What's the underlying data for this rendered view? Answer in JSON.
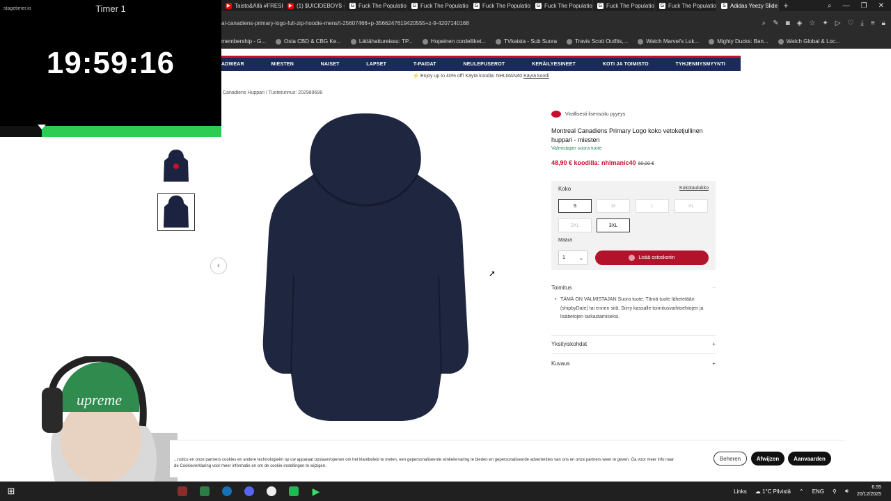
{
  "browser": {
    "tabs": [
      {
        "label": "Taisto&Allä #FRESH",
        "icon": "youtube-icon"
      },
      {
        "label": "(1) $UICIDEBOY$ -",
        "icon": "youtube-icon"
      },
      {
        "label": "Fuck The Populatio",
        "icon": "genius-icon"
      },
      {
        "label": "Fuck The Populatio",
        "icon": "genius-icon"
      },
      {
        "label": "Fuck The Populatio",
        "icon": "genius-icon"
      },
      {
        "label": "Fuck The Populatio",
        "icon": "genius-icon"
      },
      {
        "label": "Fuck The Populatio",
        "icon": "genius-icon"
      },
      {
        "label": "Fuck The Populatio",
        "icon": "genius-icon"
      },
      {
        "label": "Adidas Yeezy Slide",
        "icon": "shop-icon"
      }
    ],
    "url": "al-canadiens-primary-logo-full-zip-hoodie-mens/t-25607466+p-3566247619420555+z-9-4207140168",
    "bookmarks": [
      {
        "label": "membership - G..."
      },
      {
        "label": "Osta CBD & CBG Ke..."
      },
      {
        "label": "Lättähattureissu: TP..."
      },
      {
        "label": "Hopeinen cordelliket..."
      },
      {
        "label": "TVkaista - Sub Suora"
      },
      {
        "label": "Travis Scott Outfits,..."
      },
      {
        "label": "Watch Marvel's Luk..."
      },
      {
        "label": "Mighty Ducks: Ban..."
      },
      {
        "label": "Watch Global & Loc..."
      }
    ]
  },
  "site": {
    "nav": [
      "ADWEAR",
      "MIESTEN",
      "NAISET",
      "LAPSET",
      "T-PAIDAT",
      "NEULEPUSEROT",
      "KERÄILYESINEET",
      "KOTI JA TOIMISTO",
      "TYHJENNYSMYYNTI"
    ],
    "promo_text": "Enjoy up to 40% off! Käytä koodia: NHLMAN40",
    "promo_link": "Käytä koodi",
    "breadcrumb": "Canadiens Huppari / Tuotetunnus: 202989698"
  },
  "product": {
    "licensed": "Virallisesti lisensoitu pyyeys",
    "title": "Montreal Canadiens Primary Logo koko vetoketjullinen huppari - miesten",
    "vendor": "Valmistajan suora tuote",
    "price": "48,90 € koodilla: nhlmanic40",
    "old_price": "60,00 €",
    "size_label": "Koko",
    "size_guide": "Kokotaulukko",
    "sizes": [
      "S",
      "M",
      "L",
      "XL",
      "2XL",
      "3XL"
    ],
    "qty_label": "Määrä",
    "qty_value": "1",
    "add_to_cart": "Lisää ostoskoriin",
    "accordion_delivery": "Toimitus",
    "delivery_text": "TÄMÄ ON VALMISTAJAN Suora tuote. Tämä tuote lähetetään (shipbyDate) tai ennen sitä. Siirry kassalle toimitusvaihtoehtojen ja lisätietojen tarkastamiseksi.",
    "accordion_details": "Yksityiskohdat",
    "accordion_description": "Kuvaus"
  },
  "timer": {
    "brand": "stagetimer.io",
    "name": "Timer 1",
    "time": "19:59:16",
    "progress_remaining": 0.81
  },
  "cookie": {
    "text": "...notics en onze partners cookies en andere technologieën op uw apparaat opslaan/openen om het klantbeleid te meten, een gepersonaliseerde winkelervaring te bieden en gepersonaliseerde advertenties van ons en onze partners weer te geven. Ga voor meer info naar de Cookieverklaring voor meer informatie en om de cookie-instellingen te wijzigen.",
    "settings": "Beheren",
    "reject": "Afwijzen",
    "accept": "Aanvaarden"
  },
  "taskbar": {
    "links": "Links",
    "weather": "1°C Pilvistä",
    "lang": "ENG",
    "time": "6.55",
    "date": "20/12/2025"
  }
}
